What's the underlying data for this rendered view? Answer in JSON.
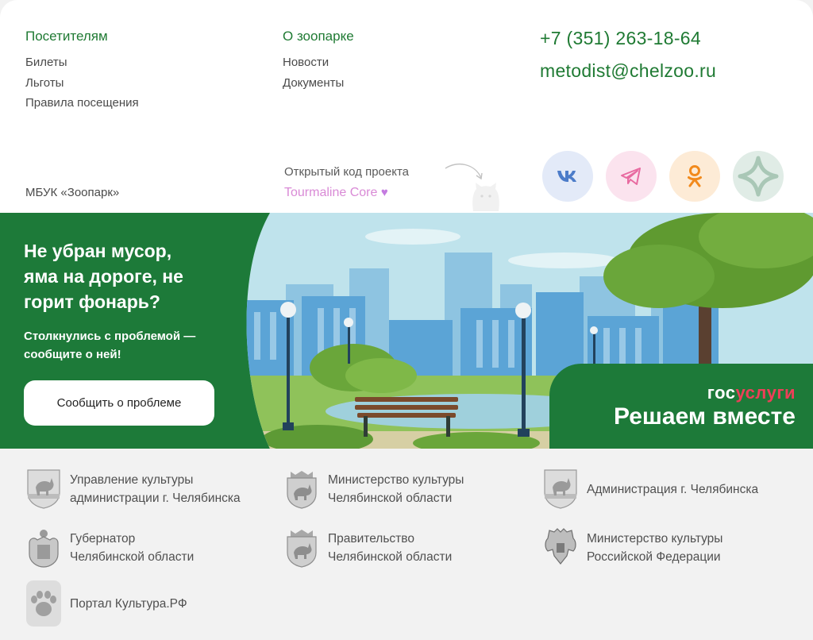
{
  "footer": {
    "visitors": {
      "heading": "Посетителям",
      "links": [
        "Билеты",
        "Льготы",
        "Правила посещения"
      ]
    },
    "about": {
      "heading": "О зоопарке",
      "links": [
        "Новости",
        "Документы"
      ]
    },
    "contacts": {
      "phone": "+7 (351) 263-18-64",
      "email": "metodist@chelzoo.ru"
    },
    "org_name": "МБУК «Зоопарк»",
    "open_source": {
      "label": "Открытый код проекта",
      "link": "Tourmaline Core",
      "heart": "♥"
    },
    "socials": [
      {
        "name": "vk",
        "icon": "vk-icon",
        "color": "#4c7cc9"
      },
      {
        "name": "telegram",
        "icon": "telegram-icon",
        "color": "#e86aa0"
      },
      {
        "name": "odnoklassniki",
        "icon": "ok-icon",
        "color": "#f28a1c"
      },
      {
        "name": "max",
        "icon": "max-icon",
        "color": "#a9c7b6"
      }
    ]
  },
  "banner": {
    "title": "Не убран мусор,\nяма на дороге, не\nгорит фонарь?",
    "subtitle": "Столкнулись с проблемой —\nсообщите о ней!",
    "button": "Сообщить о проблеме",
    "gos_logo_part1": "гос",
    "gos_logo_part2": "услуги",
    "gos_slogan": "Решаем вместе",
    "colors": {
      "background": "#1d7a39",
      "gos_red": "#ee3f58"
    }
  },
  "partners": [
    {
      "text": "Управление культуры\nадминистрации г. Челябинска",
      "icon": "chelyabinsk-coat-of-arms-icon"
    },
    {
      "text": "Министерство культуры\nЧелябинской области",
      "icon": "chelyabinsk-oblast-coat-of-arms-icon"
    },
    {
      "text": "Администрация г. Челябинска",
      "icon": "chelyabinsk-coat-of-arms-icon"
    },
    {
      "text": "Губернатор\nЧелябинской области",
      "icon": "governor-coat-of-arms-icon"
    },
    {
      "text": "Правительство\nЧелябинской области",
      "icon": "chelyabinsk-oblast-coat-of-arms-icon"
    },
    {
      "text": "Министерство культуры\nРоссийской Федерации",
      "icon": "russia-eagle-icon"
    },
    {
      "text": "Портал Культура.РФ",
      "icon": "bear-paw-icon"
    }
  ]
}
